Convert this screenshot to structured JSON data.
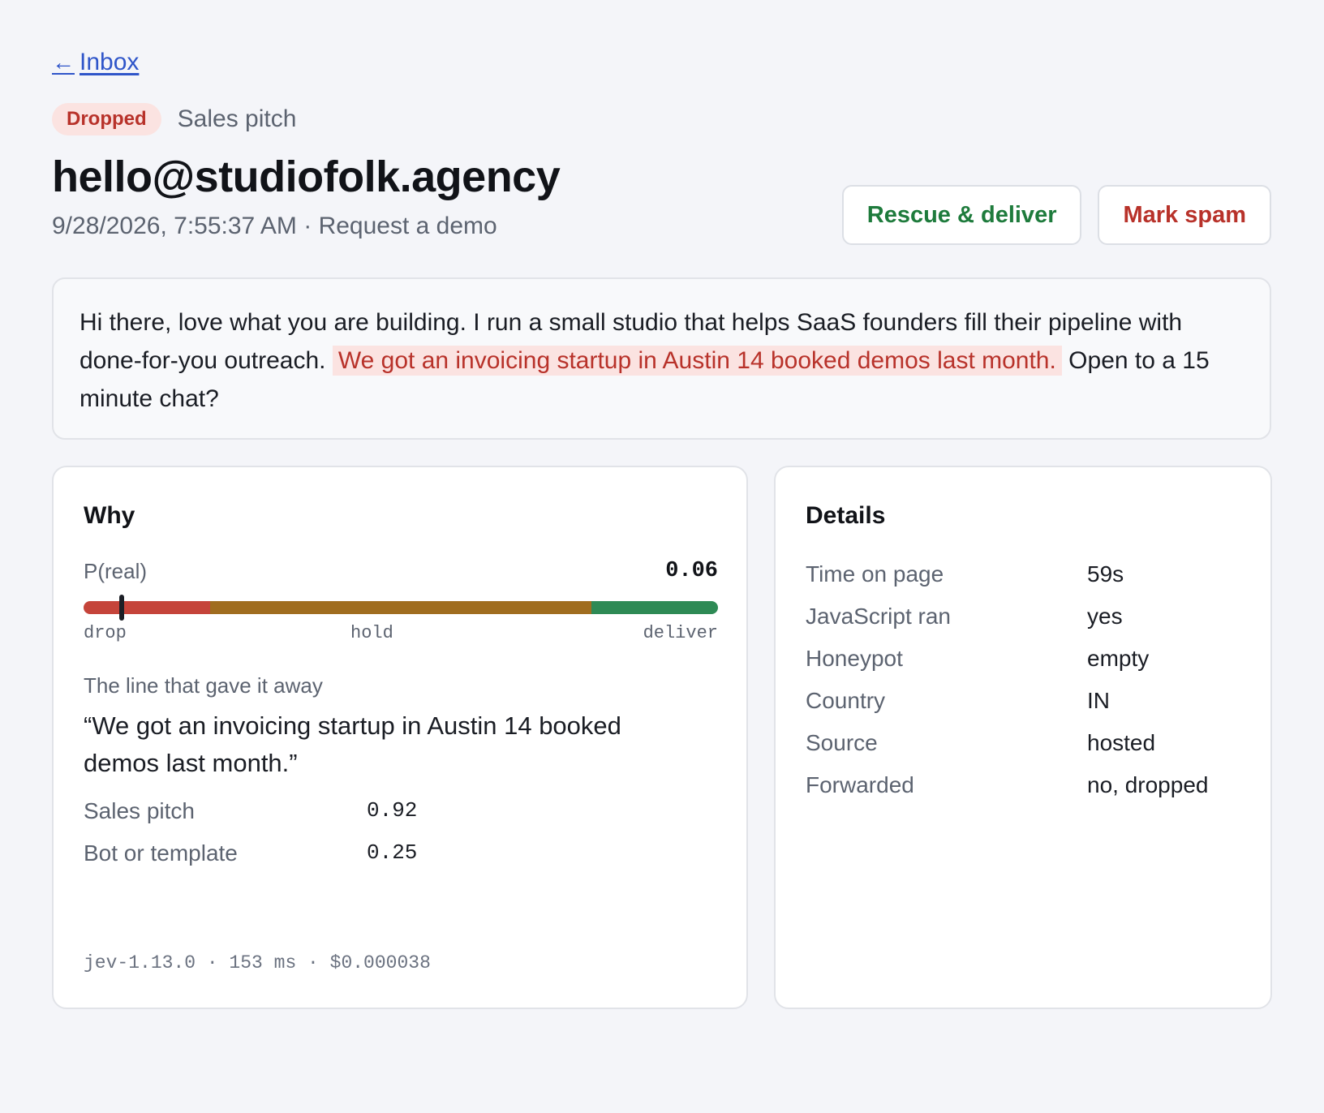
{
  "nav": {
    "back_arrow": "←",
    "back_label": "Inbox"
  },
  "header": {
    "status_badge": "Dropped",
    "category": "Sales pitch",
    "sender": "hello@studiofolk.agency",
    "timestamp": "9/28/2026, 7:55:37 AM",
    "separator": " · ",
    "form_name": "Request a demo"
  },
  "actions": {
    "rescue_label": "Rescue & deliver",
    "spam_label": "Mark spam"
  },
  "message": {
    "before": "Hi there, love what you are building. I run a small studio that helps SaaS founders fill their pipeline with done-for-you outreach. ",
    "highlight": "We got an invoicing startup in Austin 14 booked demos last month.",
    "after": " Open to a 15 minute chat?"
  },
  "why": {
    "title": "Why",
    "p_label": "P(real)",
    "p_value": "0.06",
    "p_real": 0.06,
    "thresholds": {
      "drop_max": 0.2,
      "hold_max": 0.8
    },
    "scale_labels": {
      "drop": "drop",
      "hold": "hold",
      "deliver": "deliver"
    },
    "giveaway_label": "The line that gave it away",
    "quote": "“We got an invoicing startup in Austin 14 booked demos last month.”",
    "scores": [
      {
        "label": "Sales pitch",
        "value": "0.92"
      },
      {
        "label": "Bot or template",
        "value": "0.25"
      }
    ],
    "footer": "jev-1.13.0 · 153 ms · $0.000038"
  },
  "details": {
    "title": "Details",
    "rows": [
      {
        "label": "Time on page",
        "value": "59s"
      },
      {
        "label": "JavaScript ran",
        "value": "yes"
      },
      {
        "label": "Honeypot",
        "value": "empty"
      },
      {
        "label": "Country",
        "value": "IN"
      },
      {
        "label": "Source",
        "value": "hosted"
      },
      {
        "label": "Forwarded",
        "value": "no, dropped"
      }
    ]
  },
  "colors": {
    "drop": "#c5443a",
    "hold": "#a06d1f",
    "deliver": "#2e8a55",
    "link": "#2f55c9",
    "badge_bg": "#fbe3e1",
    "badge_fg": "#b8322a"
  }
}
